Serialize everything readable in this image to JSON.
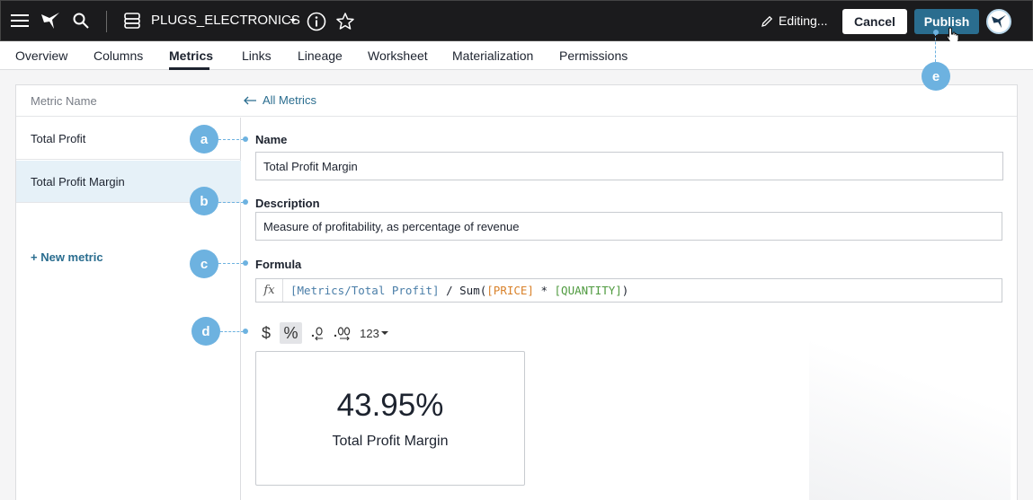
{
  "topbar": {
    "worksheet_name": "PLUGS_ELECTRONICS",
    "editing_label": "Editing...",
    "cancel_label": "Cancel",
    "publish_label": "Publish"
  },
  "tabs": [
    {
      "label": "Overview"
    },
    {
      "label": "Columns"
    },
    {
      "label": "Metrics",
      "active": true
    },
    {
      "label": "Links"
    },
    {
      "label": "Lineage"
    },
    {
      "label": "Worksheet"
    },
    {
      "label": "Materialization"
    },
    {
      "label": "Permissions"
    }
  ],
  "panel": {
    "header_label": "Metric Name",
    "back_link": "All Metrics"
  },
  "metrics": [
    {
      "name": "Total Profit"
    },
    {
      "name": "Total Profit Margin",
      "selected": true
    }
  ],
  "new_metric_label": "+ New metric",
  "form": {
    "name_label": "Name",
    "name_value": "Total Profit Margin",
    "description_label": "Description",
    "description_value": "Measure of profitability, as percentage of revenue",
    "formula_label": "Formula",
    "formula_tokens": [
      {
        "text": "[Metrics/Total Profit]",
        "color": "#4a7ea8"
      },
      {
        "text": " / Sum(",
        "color": "#1d232f"
      },
      {
        "text": "[PRICE]",
        "color": "#d9822b"
      },
      {
        "text": " * ",
        "color": "#1d232f"
      },
      {
        "text": "[QUANTITY]",
        "color": "#4f9a3f"
      },
      {
        "text": ")",
        "color": "#1d232f"
      }
    ]
  },
  "format_toolbar": {
    "currency": "$",
    "percent": "%",
    "number_format": "123"
  },
  "preview": {
    "value": "43.95%",
    "label": "Total Profit Margin"
  },
  "callouts": [
    "a",
    "b",
    "c",
    "d",
    "e"
  ],
  "colors": {
    "accent": "#2a6d8f",
    "callout": "#6db2e0",
    "topbar": "#1b1b1d"
  }
}
